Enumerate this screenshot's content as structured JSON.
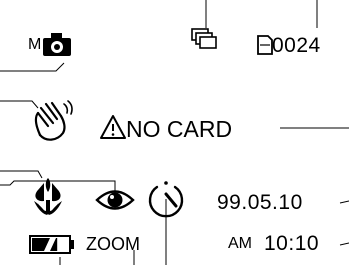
{
  "display": {
    "camera_mode": {
      "label": "M",
      "icon": "camera-icon"
    },
    "drive_mode": {
      "icon": "continuous-shooting-icon"
    },
    "frame_counter": {
      "icon": "memory-card-icon",
      "value": "0024"
    },
    "stabilizer": {
      "icon": "hand-shake-warning-icon"
    },
    "card_warning": {
      "icon": "warning-triangle-icon",
      "text": "NO CARD"
    },
    "macro": {
      "icon": "macro-flower-icon"
    },
    "red_eye": {
      "icon": "red-eye-icon"
    },
    "self_timer": {
      "icon": "self-timer-icon"
    },
    "date": "99.05.10",
    "time": {
      "ampm": "AM",
      "value": "10:10"
    },
    "battery": {
      "icon": "battery-icon",
      "level": 0.7
    },
    "zoom": {
      "label": "ZOOM"
    }
  },
  "colors": {
    "ink": "#000000",
    "background": "#ffffff"
  }
}
